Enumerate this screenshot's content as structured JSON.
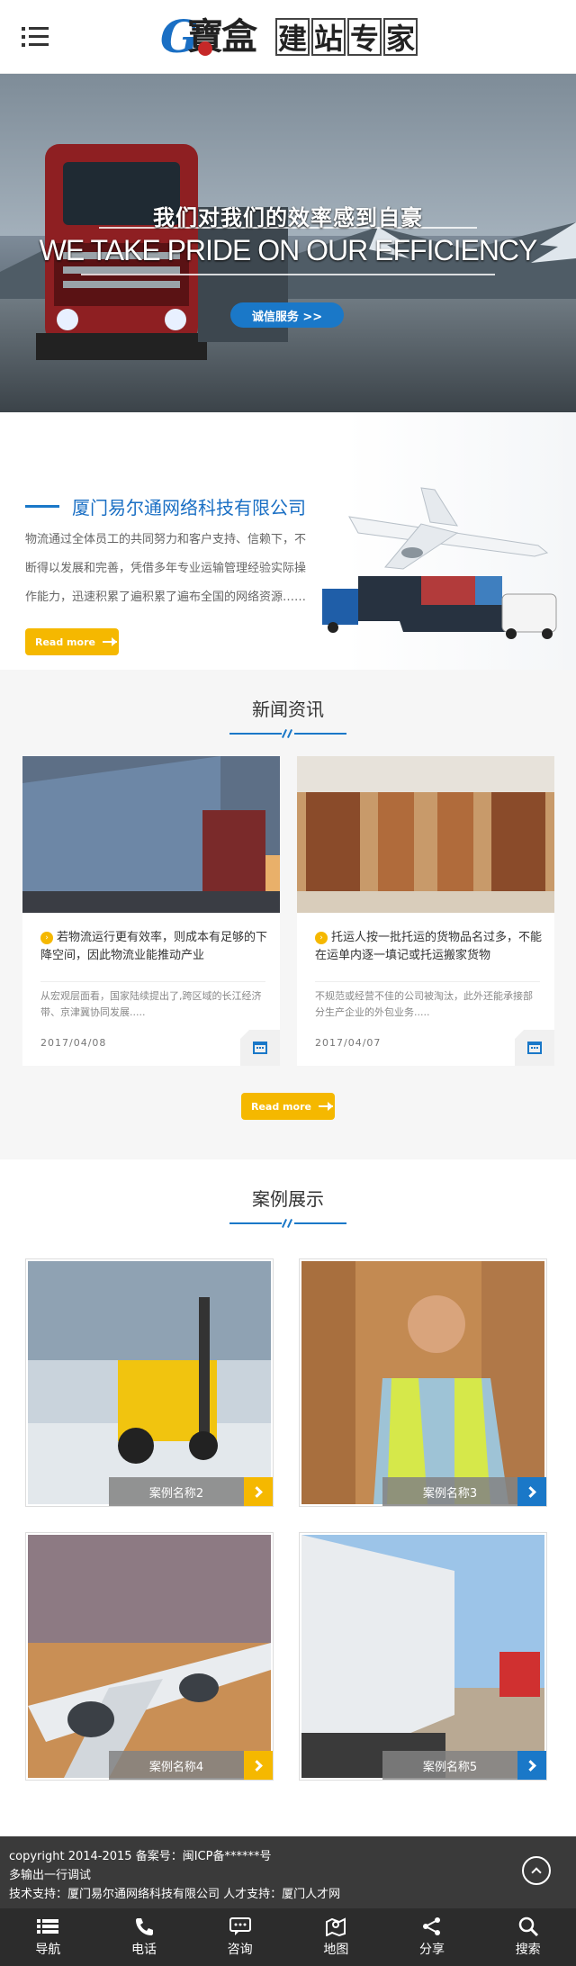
{
  "header": {
    "menu_icon": "list-icon",
    "logo_g": "G",
    "logo_cn": "寶盒",
    "logo_words": [
      "建",
      "站",
      "专",
      "家"
    ]
  },
  "banner": {
    "headline_cn": "我们对我们的效率感到自豪",
    "headline_en": "WE TAKE PRIDE ON OUR EFFICIENCY",
    "cta": "诚信服务 >>"
  },
  "about": {
    "title": "厦门易尔通网络科技有限公司",
    "description": "物流通过全体员工的共同努力和客户支持、信赖下，不断得以发展和完善，凭借多年专业运输管理经验实际操作能力，迅速积累了遍积累了遍布全国的网络资源……",
    "more": "Read more"
  },
  "news": {
    "title": "新闻资讯",
    "items": [
      {
        "title": "若物流运行更有效率，则成本有足够的下降空间，因此物流业能推动产业",
        "summary": "从宏观层面看，国家陆续提出了,跨区域的长江经济带、京津冀协同发展.....",
        "date": "2017/04/08"
      },
      {
        "title": "托运人按一批托运的货物品名过多，不能在运单内逐一填记或托运搬家货物",
        "summary": "不规范或经营不佳的公司被淘汰，此外还能承接部分生产企业的外包业务.....",
        "date": "2017/04/07"
      }
    ],
    "more": "Read more"
  },
  "cases": {
    "title": "案例展示",
    "items": [
      {
        "label": "案例名称2",
        "accent": "#f5b800"
      },
      {
        "label": "案例名称3",
        "accent": "#1a78c8"
      },
      {
        "label": "案例名称4",
        "accent": "#f5b800"
      },
      {
        "label": "案例名称5",
        "accent": "#1a78c8"
      }
    ]
  },
  "footer": {
    "lines": [
      "copyright 2014-2015 备案号：闽ICP备******号",
      "多输出一行调试",
      "技术支持：厦门易尔通网络科技有限公司 人才支持：厦门人才网"
    ]
  },
  "bottom_nav": [
    {
      "label": "导航",
      "icon": "menu-icon"
    },
    {
      "label": "电话",
      "icon": "phone-icon"
    },
    {
      "label": "咨询",
      "icon": "chat-icon"
    },
    {
      "label": "地图",
      "icon": "map-icon"
    },
    {
      "label": "分享",
      "icon": "share-icon"
    },
    {
      "label": "搜索",
      "icon": "search-icon"
    }
  ],
  "colors": {
    "accent_blue": "#1a78c8",
    "accent_yellow": "#f5b800",
    "footer_bg": "#3a3a3a",
    "nav_bg": "#2c2c2c"
  }
}
